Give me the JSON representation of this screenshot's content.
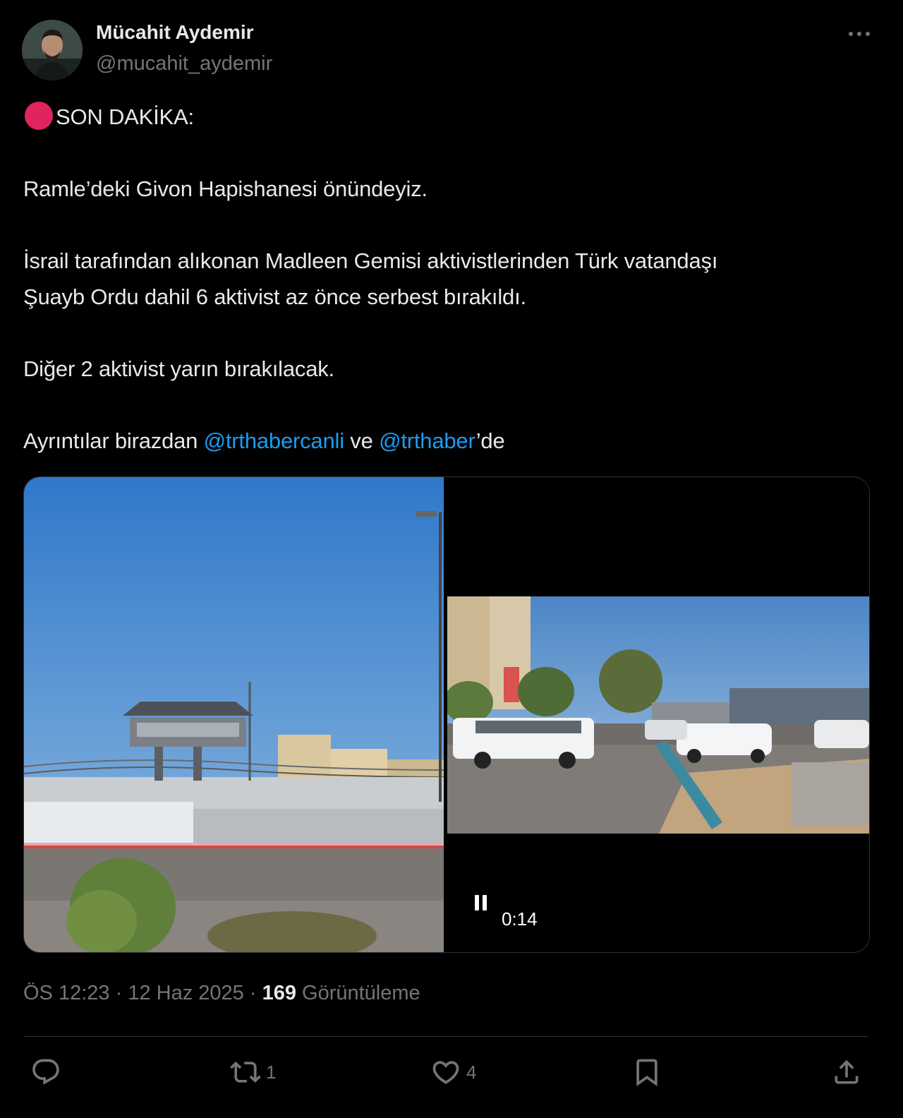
{
  "author": {
    "name": "Mücahit Aydemir",
    "handle": "@mucahit_aydemir"
  },
  "tweet": {
    "line1_label": "SON DAKİKA:",
    "line1_icon": "red-circle-emoji",
    "line2": "Ramle’deki Givon Hapishanesi önündeyiz.",
    "line3": "İsrail tarafından alıkonan Madleen Gemisi aktivistlerinden Türk vatandaşı",
    "line4": "Şuayb Ordu dahil 6 aktivist az önce serbest bırakıldı.",
    "line5": "Diğer 2 aktivist yarın bırakılacak.",
    "line6_prefix": "Ayrıntılar birazdan ",
    "mention1": "@trthabercanli",
    "line6_mid": " ve ",
    "mention2": "@trthaber",
    "line6_suffix": "’de"
  },
  "media": {
    "video_time": "0:14"
  },
  "meta": {
    "time": "ÖS 12:23",
    "sep1": " · ",
    "date": "12 Haz 2025",
    "sep2": " · ",
    "views_count": "169",
    "views_label": " Görüntüleme"
  },
  "actions": {
    "reply_count": "",
    "retweet_count": "1",
    "like_count": "4"
  },
  "colors": {
    "background": "#000000",
    "text": "#e7e9ea",
    "secondary": "#71767b",
    "link": "#1d9bf0",
    "divider": "#2f3336"
  }
}
